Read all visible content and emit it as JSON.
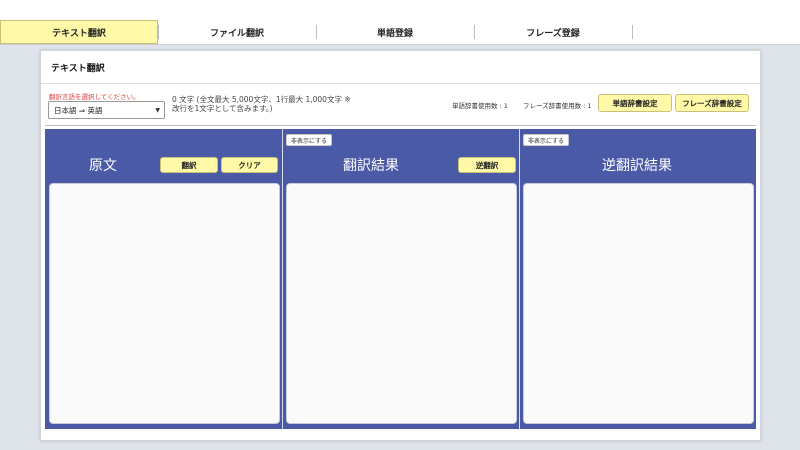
{
  "tabs": [
    {
      "label": "テキスト翻訳",
      "active": true
    },
    {
      "label": "ファイル翻訳",
      "active": false
    },
    {
      "label": "単語登録",
      "active": false
    },
    {
      "label": "フレーズ登録",
      "active": false
    }
  ],
  "card": {
    "title": "テキスト翻訳"
  },
  "controls": {
    "lang_hint": "翻訳言語を選択してください。",
    "lang_select_value": "日本語 ⇒ 英語",
    "char_info": "0 文字 (全文最大 5,000文字、1行最大 1,000文字 ※改行を1文字として含みます。)",
    "word_dict_count": "単語辞書使用数 : 1",
    "phrase_dict_count": "フレーズ辞書使用数 : 1",
    "word_dict_button": "単語辞書設定",
    "phrase_dict_button": "フレーズ辞書設定"
  },
  "panels": {
    "source": {
      "title": "原文",
      "translate_button": "翻訳",
      "clear_button": "クリア"
    },
    "result": {
      "title": "翻訳結果",
      "hide_button": "非表示にする",
      "reverse_button": "逆翻訳"
    },
    "reverse": {
      "title": "逆翻訳結果",
      "hide_button": "非表示にする"
    }
  },
  "colors": {
    "panel_bg": "#4a5aa6",
    "button_yellow": "#fff9a8",
    "hint_red": "#e03a3a"
  }
}
